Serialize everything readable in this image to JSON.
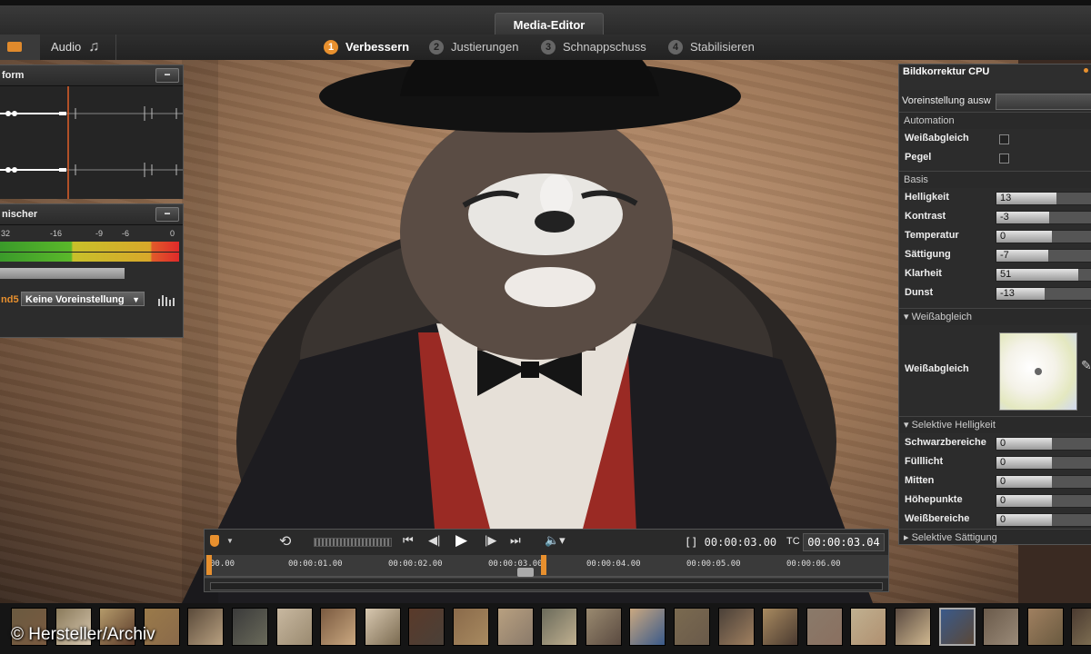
{
  "window": {
    "title": "Media-Editor"
  },
  "tabs": {
    "audio_label": "Audio",
    "steps": [
      {
        "num": "1",
        "label": "Verbessern",
        "active": true
      },
      {
        "num": "2",
        "label": "Justierungen",
        "active": false
      },
      {
        "num": "3",
        "label": "Schnappschuss",
        "active": false
      },
      {
        "num": "4",
        "label": "Stabilisieren",
        "active": false
      }
    ]
  },
  "waveform_panel": {
    "title": "form"
  },
  "mixer_panel": {
    "title": "nischer",
    "scale": [
      "32",
      "-16",
      "-9",
      "-6",
      "0"
    ],
    "preset_prefix": "nd5",
    "preset_value": "Keine Voreinstellung"
  },
  "correction_panel": {
    "title": "Bildkorrektur CPU",
    "preset_label": "Voreinstellung ausw",
    "automation": {
      "title": "Automation",
      "items": [
        {
          "label": "Weißabgleich"
        },
        {
          "label": "Pegel"
        }
      ]
    },
    "basis": {
      "title": "Basis",
      "sliders": [
        {
          "label": "Helligkeit",
          "value": "13",
          "fill": 0.6
        },
        {
          "label": "Kontrast",
          "value": "-3",
          "fill": 0.53
        },
        {
          "label": "Temperatur",
          "value": "0",
          "fill": 0.55
        },
        {
          "label": "Sättigung",
          "value": "-7",
          "fill": 0.52
        },
        {
          "label": "Klarheit",
          "value": "51",
          "fill": 0.82
        },
        {
          "label": "Dunst",
          "value": "-13",
          "fill": 0.48
        }
      ]
    },
    "white_balance": {
      "title": "Weißabgleich",
      "label": "Weißabgleich"
    },
    "selective_brightness": {
      "title": "Selektive Helligkeit",
      "sliders": [
        {
          "label": "Schwarzbereiche",
          "value": "0",
          "fill": 0.55
        },
        {
          "label": "Fülllicht",
          "value": "0",
          "fill": 0.55
        },
        {
          "label": "Mitten",
          "value": "0",
          "fill": 0.55
        },
        {
          "label": "Höhepunkte",
          "value": "0",
          "fill": 0.55
        },
        {
          "label": "Weißbereiche",
          "value": "0",
          "fill": 0.55
        }
      ]
    },
    "selective_saturation": {
      "title": "Selektive Sättigung"
    }
  },
  "transport": {
    "in_out_timecode": "[] 00:00:03.00",
    "tc_label": "TC",
    "tc_value": "00:00:03.04",
    "ruler": [
      "00.00",
      "00:00:01.00",
      "00:00:02.00",
      "00:00:03.00",
      "00:00:04.00",
      "00:00:05.00",
      "00:00:06.00"
    ]
  },
  "credit": "© Hersteller/Archiv",
  "colors": {
    "accent": "#e8902e",
    "panel_bg": "#2c2c2c"
  }
}
